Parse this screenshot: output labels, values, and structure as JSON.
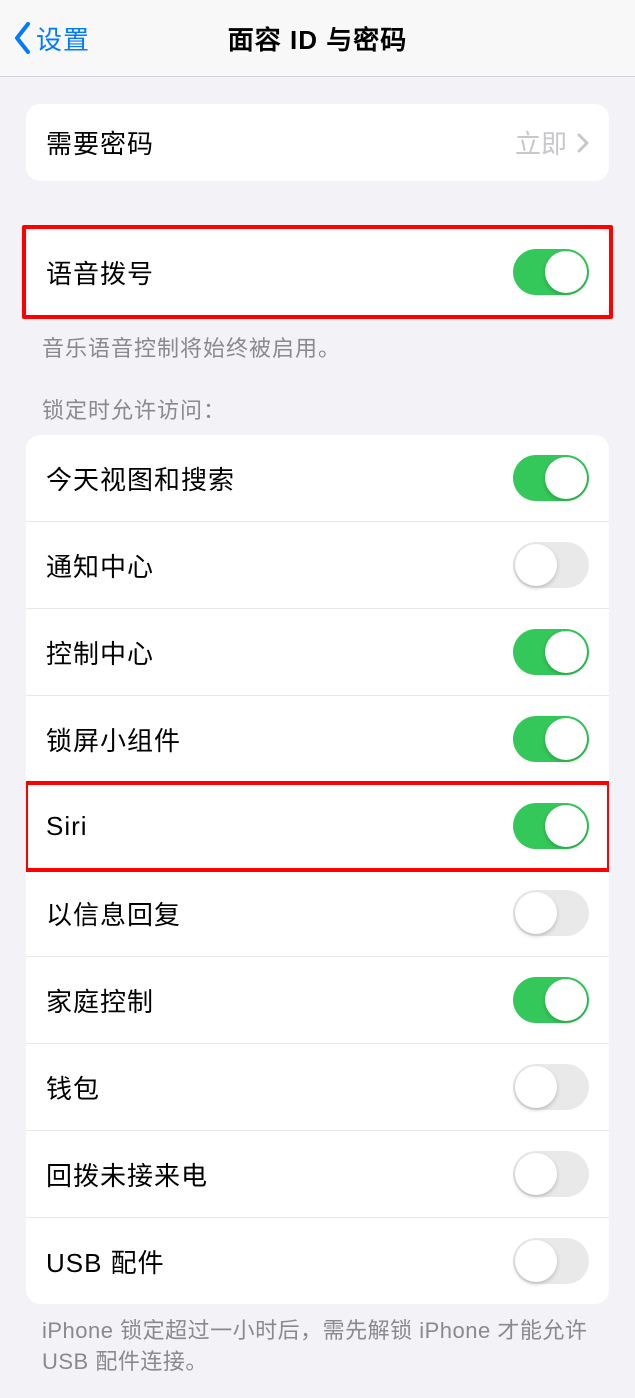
{
  "header": {
    "back": "设置",
    "title": "面容 ID 与密码"
  },
  "requirePasscode": {
    "label": "需要密码",
    "value": "立即"
  },
  "voiceDial": {
    "label": "语音拨号",
    "caption": "音乐语音控制将始终被启用。"
  },
  "lockAccess": {
    "header": "锁定时允许访问：",
    "items": [
      {
        "label": "今天视图和搜索",
        "on": true
      },
      {
        "label": "通知中心",
        "on": false
      },
      {
        "label": "控制中心",
        "on": true
      },
      {
        "label": "锁屏小组件",
        "on": true
      },
      {
        "label": "Siri",
        "on": true
      },
      {
        "label": "以信息回复",
        "on": false
      },
      {
        "label": "家庭控制",
        "on": true
      },
      {
        "label": "钱包",
        "on": false
      },
      {
        "label": "回拨未接来电",
        "on": false
      },
      {
        "label": "USB 配件",
        "on": false
      }
    ]
  },
  "footer": "iPhone 锁定超过一小时后，需先解锁 iPhone 才能允许 USB 配件连接。"
}
